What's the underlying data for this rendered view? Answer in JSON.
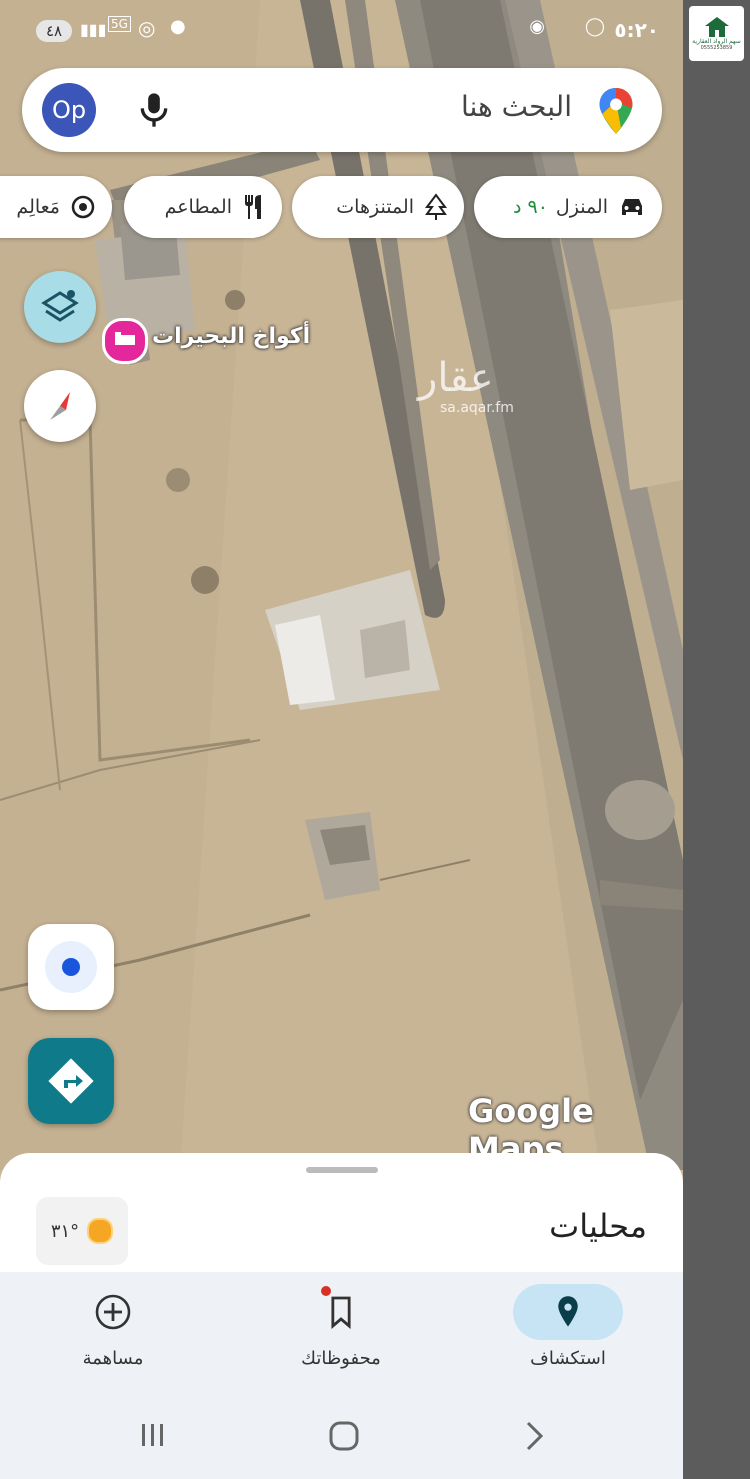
{
  "status_bar": {
    "time": "٥:٢٠",
    "battery": "٤٨",
    "network": "5G"
  },
  "search": {
    "placeholder": "البحث هنا",
    "avatar": "Op"
  },
  "chips": [
    {
      "label": "المنزل",
      "eta": "٩٠ د",
      "icon": "car-icon"
    },
    {
      "label": "المتنزهات",
      "icon": "tree-icon"
    },
    {
      "label": "المطاعم",
      "icon": "restaurant-icon"
    },
    {
      "label": "مَعالِم",
      "icon": "landmark-icon"
    }
  ],
  "map": {
    "place_label": "أكواخ البحيرات",
    "watermark": "عقار",
    "watermark_sub": "sa.aqar.fm",
    "brand": "Google Maps"
  },
  "sheet": {
    "title": "محليات",
    "weather": "٣١°"
  },
  "bottom_nav": [
    {
      "label": "استكشاف",
      "icon": "location-pin-icon",
      "active": true
    },
    {
      "label": "محفوظاتك",
      "icon": "bookmark-icon",
      "active": false
    },
    {
      "label": "مساهمة",
      "icon": "add-circle-icon",
      "active": false
    }
  ],
  "logo": {
    "text": "سهم الرواد العقارية",
    "phone": "0555253859"
  },
  "colors": {
    "accent": "#0f7b8a",
    "avatar": "#3b55b8",
    "place_pin": "#e4289c",
    "active_nav": "#c6e4f4",
    "eta": "#1e8e3e"
  }
}
